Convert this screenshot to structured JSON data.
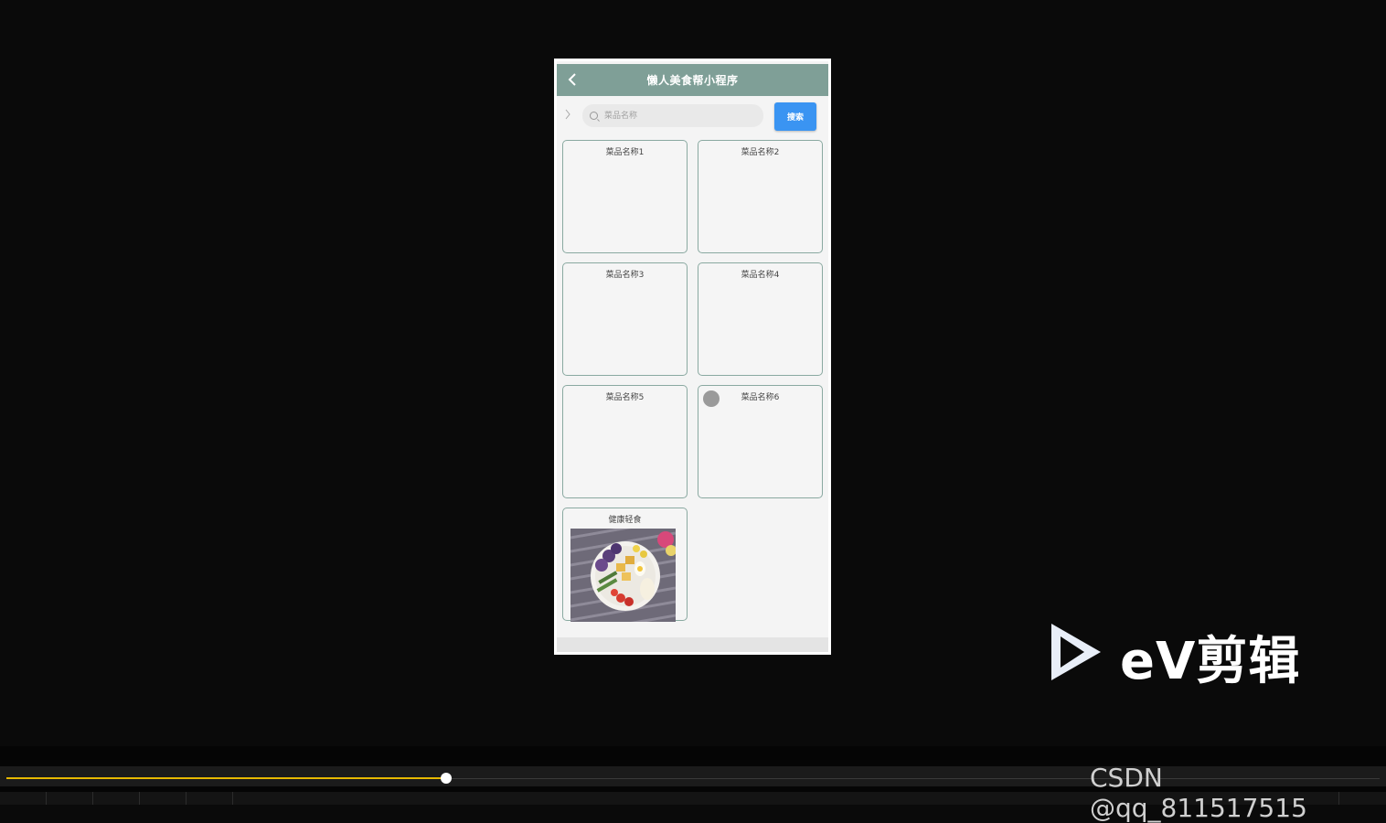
{
  "app": {
    "title": "懒人美食帮小程序",
    "back_icon": "chevron-left-icon"
  },
  "search": {
    "placeholder": "菜品名称",
    "button_label": "搜索",
    "button_color": "#3a94f2",
    "chevron_icon": "chevron-right-icon"
  },
  "colors": {
    "nav_bar": "#7f9f97",
    "card_border": "#8aa9a1"
  },
  "items": [
    {
      "name": "菜品名称1"
    },
    {
      "name": "菜品名称2"
    },
    {
      "name": "菜品名称3"
    },
    {
      "name": "菜品名称4"
    },
    {
      "name": "菜品名称5"
    },
    {
      "name": "菜品名称6"
    },
    {
      "name": "健康轻食"
    }
  ],
  "player": {
    "progress": 0.32,
    "watermark_logo_text": "eV剪辑",
    "csdn_watermark": "CSDN @qq_811517515"
  }
}
